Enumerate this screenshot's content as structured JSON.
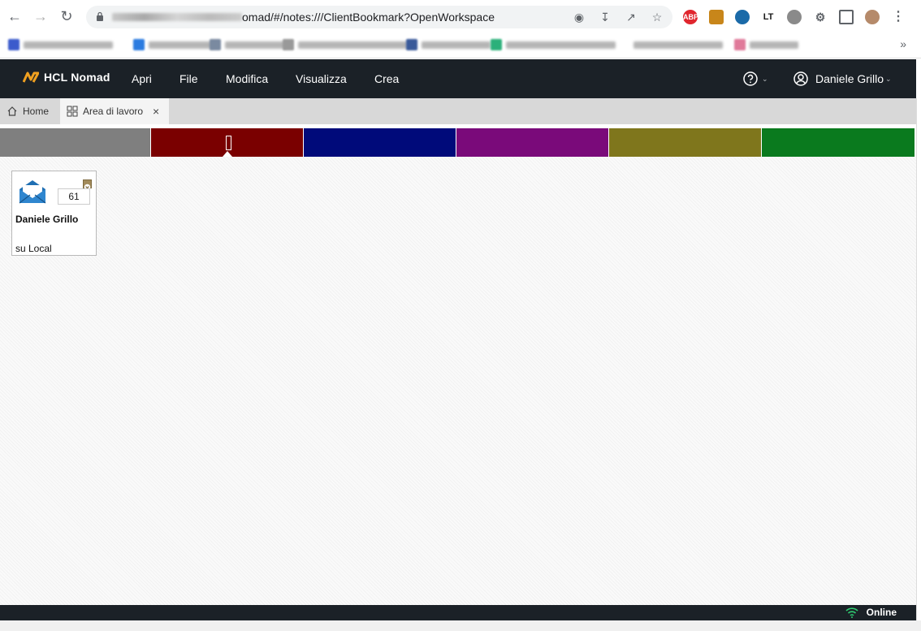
{
  "browser": {
    "url_visible": "omad/#/notes:///ClientBookmark?OpenWorkspace",
    "extensions": [
      "ABP"
    ],
    "more_label": "»"
  },
  "app": {
    "brand": "HCL Nomad",
    "menu": [
      "Apri",
      "File",
      "Modifica",
      "Visualizza",
      "Crea"
    ],
    "user_name": "Daniele Grillo"
  },
  "tabs": [
    {
      "label": "Home"
    },
    {
      "label": "Area di lavoro",
      "active": true
    }
  ],
  "bands": {
    "colors": [
      "#7f7f7f",
      "#7a0000",
      "#000a7a",
      "#7a0a7a",
      "#7f761c",
      "#0a7a1e"
    ],
    "selected_index": 1
  },
  "tile": {
    "count": "61",
    "name": "Daniele Grillo",
    "location": "su Local"
  },
  "status": {
    "text": "Online",
    "color": "#2ecc71"
  }
}
